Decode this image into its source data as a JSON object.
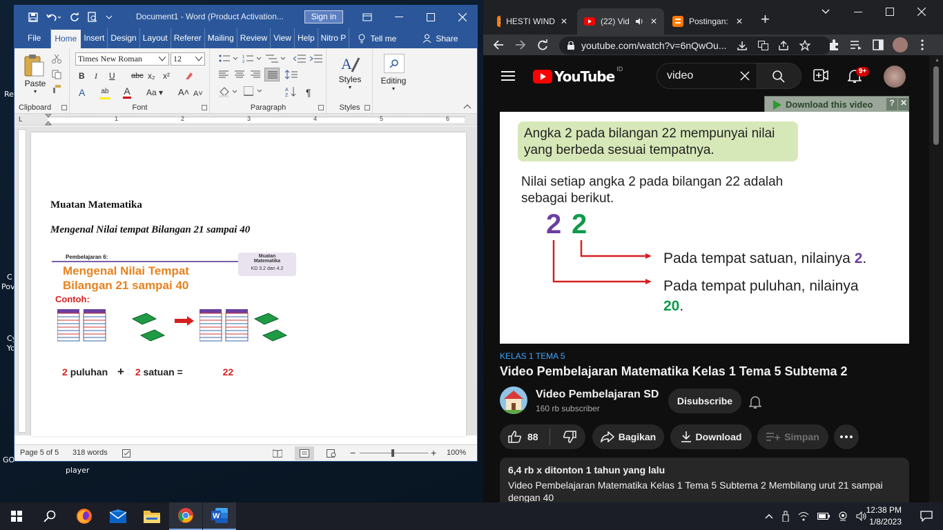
{
  "desktop": {
    "labels": [
      "Re",
      "C",
      "Pov",
      "Cy",
      "Yo",
      "GO",
      "player"
    ]
  },
  "word": {
    "title": "Document1 - Word (Product Activation...",
    "sign_in": "Sign in",
    "tabs": [
      "File",
      "Home",
      "Insert",
      "Design",
      "Layout",
      "Referer",
      "Mailing",
      "Review",
      "View",
      "Help",
      "Nitro P"
    ],
    "tell_me": "Tell me",
    "share": "Share",
    "ribbon": {
      "paste": "Paste",
      "font_name": "Times New Roman",
      "font_size": "12",
      "styles": "Styles",
      "editing": "Editing",
      "groups": [
        "Clipboard",
        "Font",
        "Paragraph",
        "Styles"
      ]
    },
    "doc": {
      "heading": "Muatan Matematika",
      "subheading": "Mengenal Nilai tempat Bilangan 21 sampai 40",
      "image": {
        "lesson": "Pembelajaran 6:",
        "title_line1": "Mengenal Nilai Tempat",
        "title_line2": "Bilangan 21 sampai 40",
        "badge_line1": "Muatan",
        "badge_line2": "Matematika",
        "badge_kd": "KD 3.2 dan 4.2",
        "contoh": "Contoh:",
        "eq_a": "2",
        "eq_a_label": "puluhan",
        "plus": "+",
        "eq_b": "2",
        "eq_b_label": "satuan",
        "equals": "=",
        "result": "22"
      }
    },
    "status": {
      "page": "Page 5 of 5",
      "words": "318 words",
      "zoom": "100%"
    }
  },
  "chrome": {
    "tabs": [
      {
        "label": "HESTI WIND",
        "icon": "blogger-icon"
      },
      {
        "label": "(22) Vid",
        "icon": "youtube-icon"
      },
      {
        "label": "Postingan: ",
        "icon": "blogger-icon"
      }
    ],
    "url": "youtube.com/watch?v=6nQwOu...",
    "youtube": {
      "logo": "YouTube",
      "region": "ID",
      "search_value": "video",
      "notif_count": "9+",
      "download_bar": "Download this video",
      "video": {
        "box_text_line1": "Angka 2 pada bilangan 22 mempunyai nilai",
        "box_text_line2": "yang berbeda sesuai tempatnya.",
        "body_line1": "Nilai setiap angka 2 pada bilangan 22 adalah",
        "body_line2": "sebagai berikut.",
        "digit_tens": "2",
        "digit_ones": "2",
        "satuan_text": "Pada tempat satuan, nilainya",
        "satuan_value": "2",
        "puluhan_text": "Pada tempat puluhan, nilainya",
        "puluhan_value": "20",
        "period": "."
      },
      "category": "KELAS 1 TEMA 5",
      "title": "Video Pembelajaran Matematika Kelas 1 Tema 5 Subtema 2",
      "channel": "Video Pembelajaran SD",
      "subscribers": "160 rb subscriber",
      "subscribe_btn": "Disubscribe",
      "likes": "88",
      "share": "Bagikan",
      "download": "Download",
      "save": "Simpan",
      "desc_meta": "6,4 rb x ditonton  1 tahun yang lalu",
      "desc_line1": "Video Pembelajaran Matematika Kelas 1 Tema 5 Subtema 2 Membilang urut 21 sampai",
      "desc_line2": "dengan 40"
    }
  },
  "taskbar": {
    "time": "12:38 PM",
    "date": "1/8/2023"
  },
  "colors": {
    "word_blue": "#2b579a",
    "purple": "#6b3fa0",
    "green": "#0e9a4a",
    "orange": "#e8821e",
    "red": "#d62020",
    "yt_red": "#ff0000"
  }
}
